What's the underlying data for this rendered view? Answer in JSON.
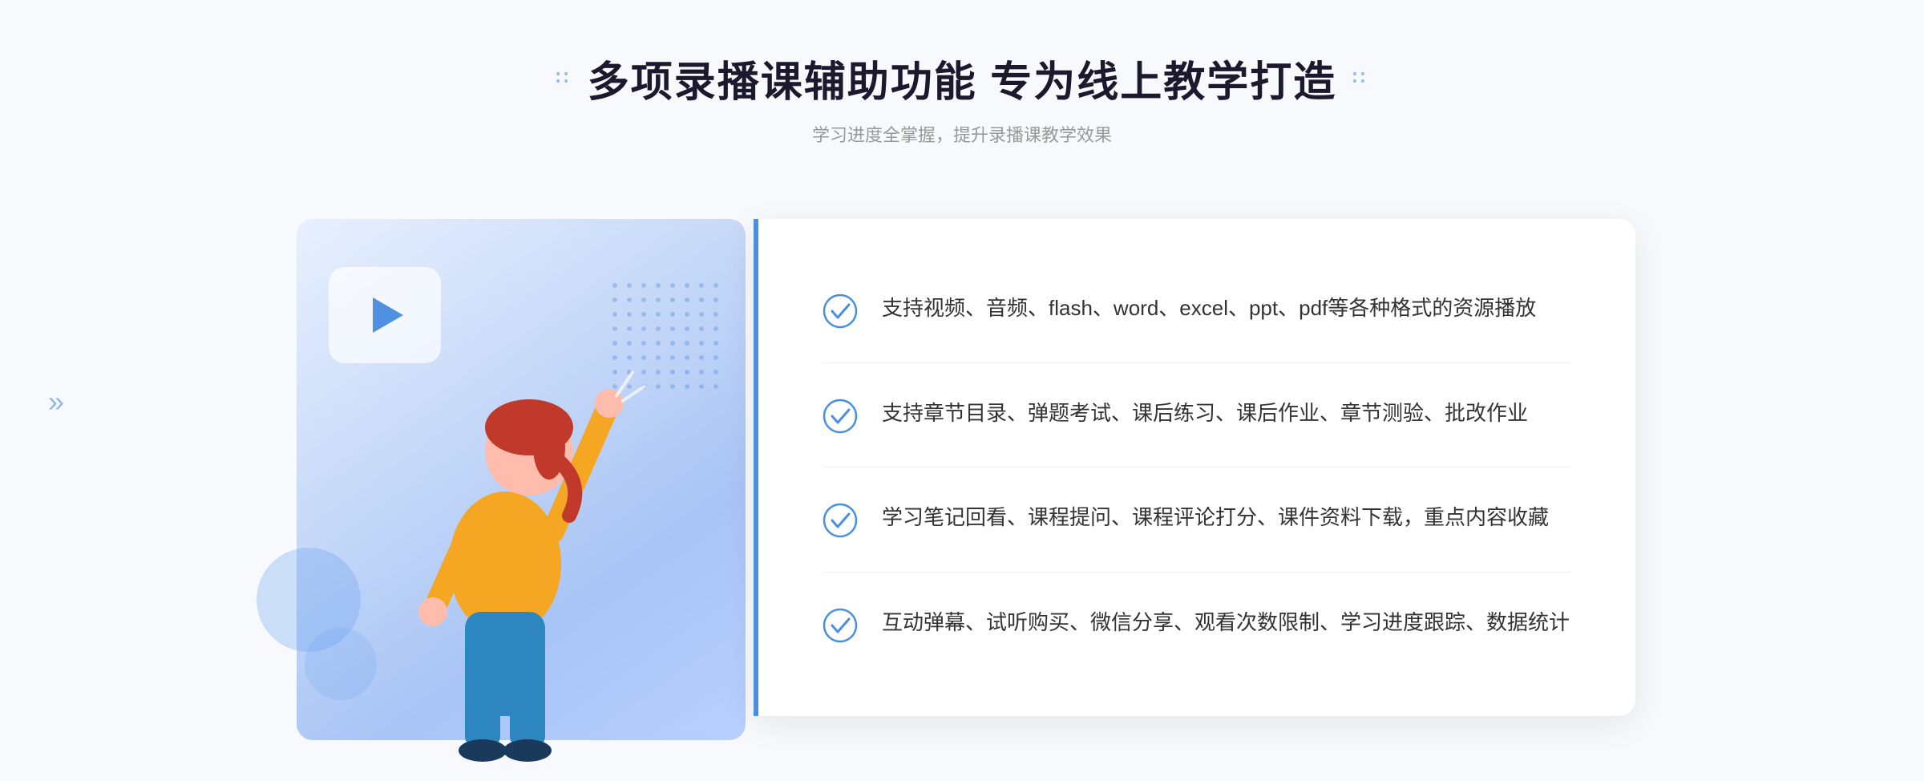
{
  "header": {
    "deco_left": "∷",
    "deco_right": "∷",
    "title": "多项录播课辅助功能 专为线上教学打造",
    "subtitle": "学习进度全掌握，提升录播课教学效果"
  },
  "features": [
    {
      "id": "feature-1",
      "text": "支持视频、音频、flash、word、excel、ppt、pdf等各种格式的资源播放"
    },
    {
      "id": "feature-2",
      "text": "支持章节目录、弹题考试、课后练习、课后作业、章节测验、批改作业"
    },
    {
      "id": "feature-3",
      "text": "学习笔记回看、课程提问、课程评论打分、课件资料下载，重点内容收藏"
    },
    {
      "id": "feature-4",
      "text": "互动弹幕、试听购买、微信分享、观看次数限制、学习进度跟踪、数据统计"
    }
  ],
  "colors": {
    "primary": "#4a90e2",
    "title": "#1a1a2e",
    "subtitle": "#999999",
    "feature_text": "#333333",
    "check_color": "#4a90e2",
    "bg": "#f8f9fc",
    "panel_bg": "#ffffff"
  },
  "icons": {
    "check_circle": "check-circle-icon",
    "play": "play-icon",
    "chevron": "chevron-icon"
  }
}
